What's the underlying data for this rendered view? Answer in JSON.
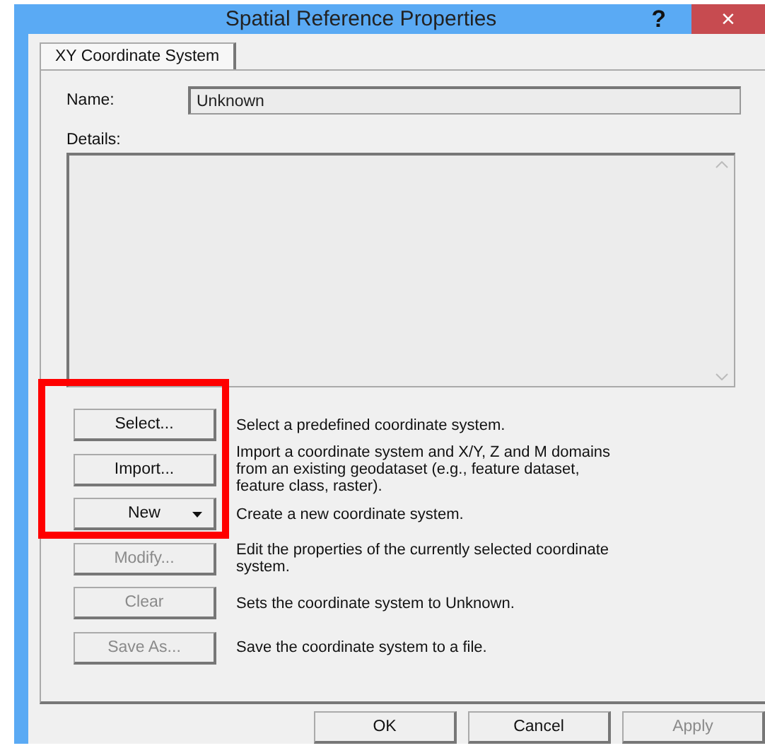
{
  "window": {
    "title": "Spatial Reference Properties",
    "help": "?",
    "close": "×"
  },
  "tabs": [
    {
      "label": "XY Coordinate System",
      "selected": true
    }
  ],
  "name_field": {
    "label": "Name:",
    "value": "Unknown"
  },
  "details": {
    "label": "Details:"
  },
  "actions": [
    {
      "button": "Select...",
      "kind": "plain",
      "disabled": false,
      "description": "Select a predefined coordinate system."
    },
    {
      "button": "Import...",
      "kind": "plain",
      "disabled": false,
      "description": "Import a coordinate system and X/Y, Z and M domains from an existing geodataset (e.g., feature dataset, feature class, raster)."
    },
    {
      "button": "New",
      "kind": "menu",
      "disabled": false,
      "description": "Create a new coordinate system."
    },
    {
      "button": "Modify...",
      "kind": "plain",
      "disabled": true,
      "description": "Edit the properties of the currently selected coordinate system."
    },
    {
      "button": "Clear",
      "kind": "plain",
      "disabled": true,
      "description": "Sets the coordinate system to Unknown."
    },
    {
      "button": "Save As...",
      "kind": "plain",
      "disabled": true,
      "description": "Save the coordinate system to a file."
    }
  ],
  "footer_buttons": [
    {
      "label": "OK",
      "disabled": false
    },
    {
      "label": "Cancel",
      "disabled": false
    },
    {
      "label": "Apply",
      "disabled": true
    }
  ]
}
